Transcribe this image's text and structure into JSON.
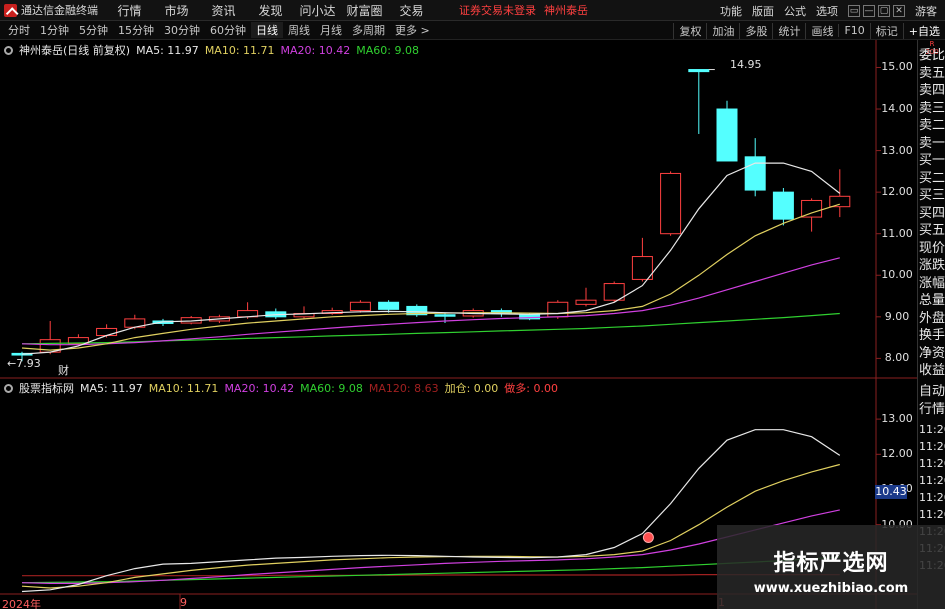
{
  "app": {
    "title": "通达信金融终端"
  },
  "menu": [
    "行情",
    "市场",
    "资讯",
    "发现",
    "问小达",
    "财富圈",
    "交易"
  ],
  "broker_login": "证券交易未登录",
  "stock_name": "神州泰岳",
  "top_right": [
    "功能",
    "版面",
    "公式",
    "选项"
  ],
  "win_buttons": [
    "▭",
    "—",
    "▢",
    "✕"
  ],
  "guest": "游客",
  "period_tabs": [
    "分时",
    "1分钟",
    "5分钟",
    "15分钟",
    "30分钟",
    "60分钟",
    "日线",
    "周线",
    "月线",
    "多周期",
    "更多 >"
  ],
  "active_period": "日线",
  "toolbar": [
    "复权",
    "加油",
    "多股",
    "统计",
    "画线",
    "F10",
    "标记"
  ],
  "self_select": "+自选",
  "main_legend": {
    "title": "神州泰岳(日线 前复权)",
    "ma5": "MA5: 11.97",
    "ma10": "MA10: 11.71",
    "ma20": "MA20: 10.42",
    "ma60": "MA60: 9.08"
  },
  "sub_legend": {
    "title": "股票指标网",
    "ma5": "MA5: 11.97",
    "ma10": "MA10: 11.71",
    "ma20": "MA20: 10.42",
    "ma60": "MA60: 9.08",
    "ma120": "MA120: 8.63",
    "jiacang": "加仓: 0.00",
    "lingduo": "做多: 0.00"
  },
  "price_axis": [
    "15.00",
    "14.00",
    "13.00",
    "12.00",
    "11.00",
    "10.00",
    "9.00",
    "8.00"
  ],
  "sub_axis": [
    "13.00",
    "12.00",
    "11.00",
    "10.00"
  ],
  "sub_last_value": "10.43",
  "high_label": "14.95",
  "low_label": "7.93",
  "cai_label": "财",
  "quote_badge": "R\n300",
  "quote_labels": [
    "委比",
    "卖五",
    "卖四",
    "卖三",
    "卖二",
    "卖一",
    "买一",
    "买二",
    "买三",
    "买四",
    "买五",
    "现价",
    "涨跌",
    "涨幅",
    "总量",
    "外盘",
    "换手",
    "净资",
    "收益"
  ],
  "quote_lower": [
    "自动",
    "行情"
  ],
  "quote_times": [
    "11:26",
    "11:26",
    "11:26",
    "11:26",
    "11:26",
    "11:26",
    "11:26",
    "11:26",
    "11:26"
  ],
  "dates": [
    "2024年",
    "9",
    "1"
  ],
  "watermark": {
    "title": "指标严选网",
    "url": "www.xuezhibiao.com"
  },
  "colors": {
    "up": "#ff4040",
    "down": "#54ffff",
    "ma5": "#e8e8e8",
    "ma10": "#e0d060",
    "ma20": "#d040e0",
    "ma60": "#30d030",
    "ma120": "#a02020"
  },
  "chart_data": {
    "type": "candlestick",
    "ylim": [
      7.6,
      15.3
    ],
    "candles": [
      {
        "o": 8.12,
        "c": 8.08,
        "h": 8.16,
        "l": 7.93
      },
      {
        "o": 8.15,
        "c": 8.45,
        "h": 8.9,
        "l": 8.1
      },
      {
        "o": 8.35,
        "c": 8.5,
        "h": 8.58,
        "l": 8.3
      },
      {
        "o": 8.55,
        "c": 8.72,
        "h": 8.82,
        "l": 8.5
      },
      {
        "o": 8.75,
        "c": 8.95,
        "h": 9.05,
        "l": 8.7
      },
      {
        "o": 8.9,
        "c": 8.84,
        "h": 8.95,
        "l": 8.78
      },
      {
        "o": 8.85,
        "c": 8.98,
        "h": 9.02,
        "l": 8.82
      },
      {
        "o": 8.9,
        "c": 9.0,
        "h": 9.05,
        "l": 8.85
      },
      {
        "o": 9.0,
        "c": 9.15,
        "h": 9.35,
        "l": 8.95
      },
      {
        "o": 9.12,
        "c": 9.0,
        "h": 9.2,
        "l": 8.95
      },
      {
        "o": 9.0,
        "c": 9.08,
        "h": 9.25,
        "l": 8.95
      },
      {
        "o": 9.08,
        "c": 9.15,
        "h": 9.22,
        "l": 9.05
      },
      {
        "o": 9.15,
        "c": 9.35,
        "h": 9.4,
        "l": 9.1
      },
      {
        "o": 9.35,
        "c": 9.18,
        "h": 9.4,
        "l": 9.1
      },
      {
        "o": 9.25,
        "c": 9.05,
        "h": 9.3,
        "l": 9.0
      },
      {
        "o": 9.05,
        "c": 9.02,
        "h": 9.1,
        "l": 8.85
      },
      {
        "o": 9.02,
        "c": 9.15,
        "h": 9.2,
        "l": 8.98
      },
      {
        "o": 9.15,
        "c": 9.08,
        "h": 9.2,
        "l": 9.0
      },
      {
        "o": 9.05,
        "c": 8.95,
        "h": 9.1,
        "l": 8.92
      },
      {
        "o": 9.0,
        "c": 9.35,
        "h": 9.4,
        "l": 8.95
      },
      {
        "o": 9.3,
        "c": 9.4,
        "h": 9.7,
        "l": 9.25
      },
      {
        "o": 9.4,
        "c": 9.8,
        "h": 9.85,
        "l": 9.35
      },
      {
        "o": 9.9,
        "c": 10.45,
        "h": 10.9,
        "l": 9.85
      },
      {
        "o": 11.0,
        "c": 12.45,
        "h": 12.5,
        "l": 10.95
      },
      {
        "o": 14.95,
        "c": 14.9,
        "h": 14.95,
        "l": 13.4
      },
      {
        "o": 14.0,
        "c": 12.75,
        "h": 14.2,
        "l": 12.75
      },
      {
        "o": 12.85,
        "c": 12.05,
        "h": 13.3,
        "l": 11.9
      },
      {
        "o": 12.0,
        "c": 11.35,
        "h": 12.1,
        "l": 11.2
      },
      {
        "o": 11.4,
        "c": 11.8,
        "h": 11.85,
        "l": 11.05
      },
      {
        "o": 11.65,
        "c": 11.9,
        "h": 12.55,
        "l": 11.4
      }
    ],
    "ma5": [
      8.1,
      8.15,
      8.3,
      8.55,
      8.75,
      8.88,
      8.9,
      8.95,
      9.0,
      9.05,
      9.07,
      9.1,
      9.12,
      9.13,
      9.12,
      9.1,
      9.08,
      9.07,
      9.06,
      9.08,
      9.15,
      9.35,
      9.75,
      10.6,
      11.6,
      12.4,
      12.7,
      12.7,
      12.5,
      11.97
    ],
    "ma10": [
      8.25,
      8.2,
      8.25,
      8.35,
      8.5,
      8.6,
      8.7,
      8.78,
      8.85,
      8.9,
      8.95,
      9.0,
      9.03,
      9.06,
      9.08,
      9.09,
      9.1,
      9.1,
      9.09,
      9.08,
      9.1,
      9.15,
      9.25,
      9.55,
      10.0,
      10.5,
      10.95,
      11.25,
      11.5,
      11.71
    ],
    "ma20": [
      8.35,
      8.33,
      8.33,
      8.35,
      8.38,
      8.42,
      8.47,
      8.52,
      8.58,
      8.63,
      8.68,
      8.73,
      8.78,
      8.82,
      8.86,
      8.9,
      8.93,
      8.96,
      8.98,
      9.0,
      9.03,
      9.08,
      9.15,
      9.28,
      9.45,
      9.65,
      9.85,
      10.05,
      10.25,
      10.42
    ],
    "ma60": [
      8.35,
      8.36,
      8.37,
      8.38,
      8.4,
      8.42,
      8.44,
      8.46,
      8.48,
      8.5,
      8.52,
      8.54,
      8.56,
      8.58,
      8.6,
      8.62,
      8.64,
      8.66,
      8.68,
      8.7,
      8.72,
      8.75,
      8.78,
      8.82,
      8.86,
      8.9,
      8.94,
      8.98,
      9.03,
      9.08
    ],
    "ma120": [
      8.6,
      8.6,
      8.6,
      8.6,
      8.6,
      8.6,
      8.6,
      8.6,
      8.6,
      8.61,
      8.61,
      8.61,
      8.61,
      8.61,
      8.62,
      8.62,
      8.62,
      8.62,
      8.62,
      8.62,
      8.62,
      8.62,
      8.62,
      8.62,
      8.63,
      8.63,
      8.63,
      8.63,
      8.63,
      8.63
    ],
    "sub_ylim": [
      8.2,
      13.6
    ],
    "signal_index": 23
  }
}
